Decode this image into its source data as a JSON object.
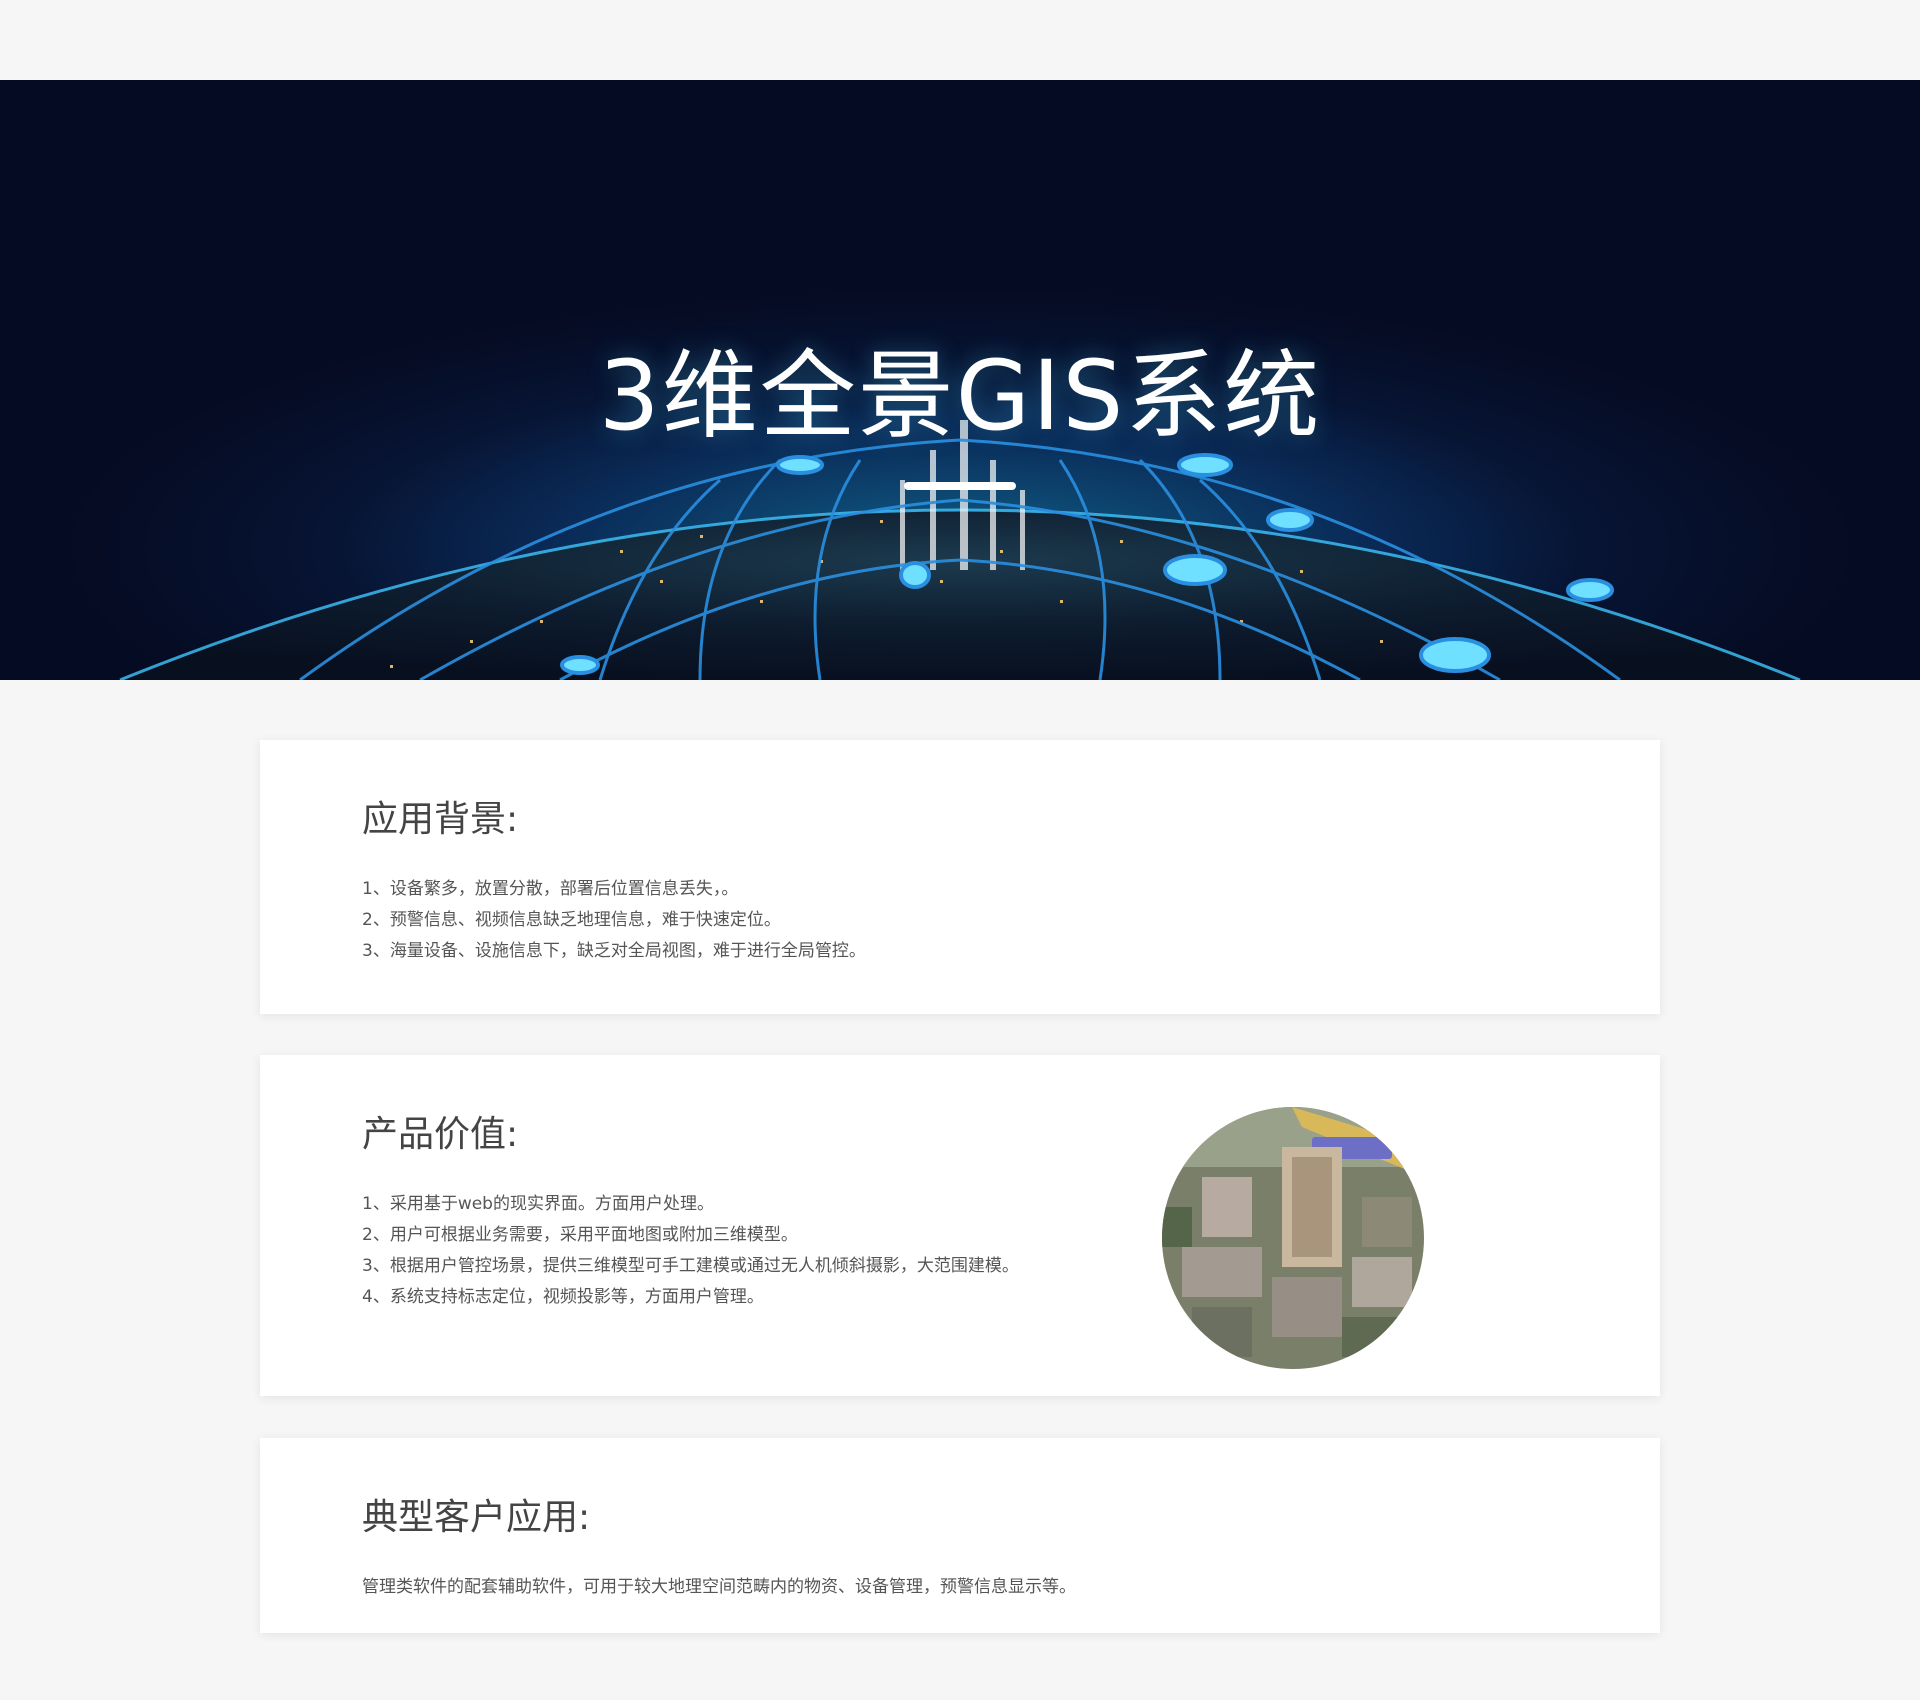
{
  "banner": {
    "title": "3维全景GIS系统"
  },
  "sections": [
    {
      "title": "应用背景:",
      "items": [
        "1、设备繁多，放置分散，部署后位置信息丢失，。",
        "2、预警信息、视频信息缺乏地理信息，难于快速定位。",
        "3、海量设备、设施信息下，缺乏对全局视图，难于进行全局管控。"
      ]
    },
    {
      "title": "产品价值:",
      "items": [
        "1、采用基于web的现实界面。方面用户处理。",
        "2、用户可根据业务需要，采用平面地图或附加三维模型。",
        "3、根据用户管控场景，提供三维模型可手工建模或通过无人机倾斜摄影，大范围建模。",
        "4、系统支持标志定位，视频投影等，方面用户管理。"
      ]
    },
    {
      "title": "典型客户应用:",
      "text": "管理类软件的配套辅助软件，可用于较大地理空间范畴内的物资、设备管理，预警信息显示等。"
    }
  ],
  "colors": {
    "page_bg": "#f6f6f6",
    "card_bg": "#ffffff",
    "heading": "#444444",
    "body_text": "#555555",
    "banner_dark": "#050b22",
    "banner_glow": "#0f5f86",
    "network_line": "#2a8fe0"
  },
  "icons": {
    "banner_art": "globe-city-network",
    "product_image": "aerial-3d-city-model"
  }
}
